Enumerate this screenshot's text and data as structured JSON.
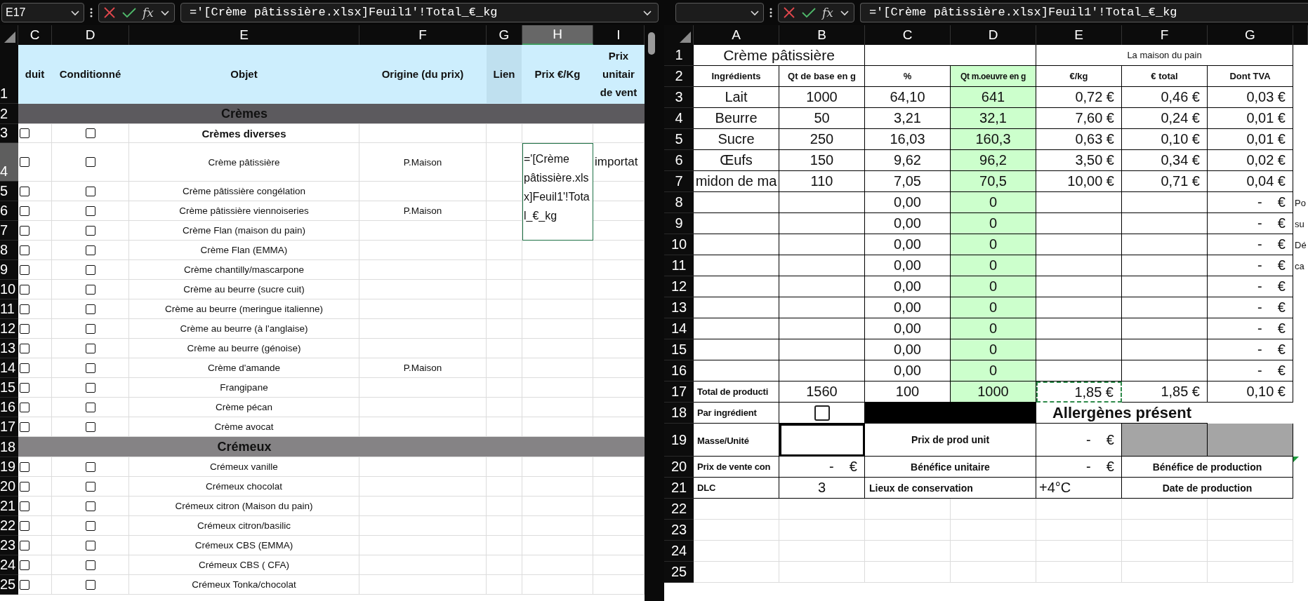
{
  "left_pane": {
    "name_box": "E17",
    "function_label": "fx",
    "formula": "='[Crème pâtissière.xlsx]Feuil1'!Total_€_kg",
    "columns": [
      {
        "label": "C",
        "selected": false
      },
      {
        "label": "D",
        "selected": false
      },
      {
        "label": "E",
        "selected": false
      },
      {
        "label": "F",
        "selected": false
      },
      {
        "label": "G",
        "selected": false
      },
      {
        "label": "H",
        "selected": true
      },
      {
        "label": "I",
        "selected": false
      }
    ],
    "rows": [
      {
        "number": "1",
        "kind": "header",
        "selected": false,
        "cells": [
          "duit",
          "Conditionné",
          "Objet",
          "Origine (du prix)",
          "Lien",
          "Prix €/Kg",
          "Prix\nunitair\nde vent"
        ]
      },
      {
        "number": "2",
        "kind": "section",
        "selected": false,
        "title": "Crèmes",
        "color": "#5c5a5e"
      },
      {
        "number": "3",
        "kind": "subheading",
        "selected": false,
        "checks": [
          {
            "checked": false
          },
          {
            "checked": false
          }
        ],
        "object": "Crèmes diverses"
      },
      {
        "number": "4",
        "kind": "editing",
        "selected": true,
        "checks": [
          {
            "checked": false
          },
          {
            "checked": false
          }
        ],
        "object": "Crème pâtissière",
        "origin": "P.Maison",
        "price": "='[Crème pâtissière.xlsx]Feuil1'!Total_€_kg",
        "unit_price": "importat"
      },
      {
        "number": "5",
        "kind": "item",
        "selected": false,
        "checks": [
          {
            "checked": false
          },
          {
            "checked": false
          }
        ],
        "object": "Crème pâtissière congélation"
      },
      {
        "number": "6",
        "kind": "item",
        "selected": false,
        "checks": [
          {
            "checked": false
          },
          {
            "checked": false
          }
        ],
        "object": "Crème pâtissière viennoiseries",
        "origin": "P.Maison"
      },
      {
        "number": "7",
        "kind": "item",
        "selected": false,
        "checks": [
          {
            "checked": false
          },
          {
            "checked": false
          }
        ],
        "object": "Crème Flan (maison du pain)"
      },
      {
        "number": "8",
        "kind": "item",
        "selected": false,
        "checks": [
          {
            "checked": false
          },
          {
            "checked": false
          }
        ],
        "object": "Crème Flan (EMMA)"
      },
      {
        "number": "9",
        "kind": "item",
        "selected": false,
        "checks": [
          {
            "checked": false
          },
          {
            "checked": false
          }
        ],
        "object": "Crème chantilly/mascarpone"
      },
      {
        "number": "10",
        "kind": "item",
        "selected": false,
        "checks": [
          {
            "checked": false
          },
          {
            "checked": false
          }
        ],
        "object": "Crème au beurre (sucre cuit)"
      },
      {
        "number": "11",
        "kind": "item",
        "selected": false,
        "checks": [
          {
            "checked": false
          },
          {
            "checked": false
          }
        ],
        "object": "Crème au beurre (meringue italienne)"
      },
      {
        "number": "12",
        "kind": "item",
        "selected": false,
        "checks": [
          {
            "checked": false
          },
          {
            "checked": false
          }
        ],
        "object": "Crème au beurre (à l'anglaise)"
      },
      {
        "number": "13",
        "kind": "item",
        "selected": false,
        "checks": [
          {
            "checked": false
          },
          {
            "checked": false
          }
        ],
        "object": "Crème au beurre (génoise)"
      },
      {
        "number": "14",
        "kind": "item",
        "selected": false,
        "checks": [
          {
            "checked": false
          },
          {
            "checked": false
          }
        ],
        "object": "Crème d'amande",
        "origin": "P.Maison"
      },
      {
        "number": "15",
        "kind": "item",
        "selected": false,
        "checks": [
          {
            "checked": false
          },
          {
            "checked": false
          }
        ],
        "object": "Frangipane"
      },
      {
        "number": "16",
        "kind": "item",
        "selected": false,
        "checks": [
          {
            "checked": false
          },
          {
            "checked": false
          }
        ],
        "object": "Crème pécan"
      },
      {
        "number": "17",
        "kind": "item",
        "selected": false,
        "checks": [
          {
            "checked": false
          },
          {
            "checked": false
          }
        ],
        "object": "Crème avocat"
      },
      {
        "number": "18",
        "kind": "section",
        "selected": false,
        "title": "Crémeux",
        "color": "#858385"
      },
      {
        "number": "19",
        "kind": "item",
        "selected": false,
        "checks": [
          {
            "checked": false
          },
          {
            "checked": false
          }
        ],
        "object": "Crémeux vanille"
      },
      {
        "number": "20",
        "kind": "item",
        "selected": false,
        "checks": [
          {
            "checked": false
          },
          {
            "checked": false
          }
        ],
        "object": "Crémeux chocolat"
      },
      {
        "number": "21",
        "kind": "item",
        "selected": false,
        "checks": [
          {
            "checked": false
          },
          {
            "checked": false
          }
        ],
        "object": "Crémeux citron (Maison du pain)"
      },
      {
        "number": "22",
        "kind": "item",
        "selected": false,
        "checks": [
          {
            "checked": false
          },
          {
            "checked": false
          }
        ],
        "object": "Crémeux citron/basilic"
      },
      {
        "number": "23",
        "kind": "item",
        "selected": false,
        "checks": [
          {
            "checked": false
          },
          {
            "checked": false
          }
        ],
        "object": "Crémeux CBS (EMMA)"
      },
      {
        "number": "24",
        "kind": "item",
        "selected": false,
        "checks": [
          {
            "checked": false
          },
          {
            "checked": false
          }
        ],
        "object": "Crémeux CBS ( CFA)"
      },
      {
        "number": "25",
        "kind": "item",
        "selected": false,
        "checks": [
          {
            "checked": false
          },
          {
            "checked": false
          }
        ],
        "object": "Crémeux Tonka/chocolat"
      }
    ]
  },
  "right_pane": {
    "function_label": "fx",
    "formula": "='[Crème pâtissière.xlsx]Feuil1'!Total_€_kg",
    "columns": [
      "A",
      "B",
      "C",
      "D",
      "E",
      "F",
      "G"
    ],
    "rows": [
      {
        "number": "1",
        "kind": "standard",
        "cells": [
          {
            "kind": "title",
            "text": "Crème pâtissière"
          },
          {
            "kind": "blank_wide"
          },
          {
            "kind": "banner",
            "text": "La maison du pain"
          }
        ]
      },
      {
        "number": "2",
        "kind": "standard",
        "cells": [
          {
            "kind": "head",
            "text": "Ingrédients"
          },
          {
            "kind": "head",
            "text": "Qt de base en g"
          },
          {
            "kind": "head",
            "text": "%"
          },
          {
            "kind": "green_head",
            "text": "Qt m.oeuvre en g"
          },
          {
            "kind": "head",
            "text": "€/kg"
          },
          {
            "kind": "head",
            "text": "€ total"
          },
          {
            "kind": "head",
            "text": "Dont TVA"
          }
        ]
      },
      {
        "number": "3",
        "kind": "standard",
        "cells": [
          {
            "kind": "num",
            "text": "Lait"
          },
          {
            "kind": "num",
            "text": "1000"
          },
          {
            "kind": "num",
            "text": "64,10"
          },
          {
            "kind": "green",
            "text": "641"
          },
          {
            "kind": "money",
            "text": "0,72 €"
          },
          {
            "kind": "money",
            "text": "0,46 €"
          },
          {
            "kind": "money",
            "text": "0,03 €"
          }
        ]
      },
      {
        "number": "4",
        "kind": "standard",
        "cells": [
          {
            "kind": "num",
            "text": "Beurre"
          },
          {
            "kind": "num",
            "text": "50"
          },
          {
            "kind": "num",
            "text": "3,21"
          },
          {
            "kind": "green",
            "text": "32,1"
          },
          {
            "kind": "money",
            "text": "7,60 €"
          },
          {
            "kind": "money",
            "text": "0,24 €"
          },
          {
            "kind": "money",
            "text": "0,01 €"
          }
        ]
      },
      {
        "number": "5",
        "kind": "standard",
        "cells": [
          {
            "kind": "num",
            "text": "Sucre"
          },
          {
            "kind": "num",
            "text": "250"
          },
          {
            "kind": "num",
            "text": "16,03"
          },
          {
            "kind": "green",
            "text": "160,3"
          },
          {
            "kind": "money",
            "text": "0,63 €"
          },
          {
            "kind": "money",
            "text": "0,10 €"
          },
          {
            "kind": "money",
            "text": "0,01 €"
          }
        ]
      },
      {
        "number": "6",
        "kind": "standard",
        "cells": [
          {
            "kind": "num",
            "text": "Œufs"
          },
          {
            "kind": "num",
            "text": "150"
          },
          {
            "kind": "num",
            "text": "9,62"
          },
          {
            "kind": "green",
            "text": "96,2"
          },
          {
            "kind": "money",
            "text": "3,50 €"
          },
          {
            "kind": "money",
            "text": "0,34 €"
          },
          {
            "kind": "money",
            "text": "0,02 €"
          }
        ]
      },
      {
        "number": "7",
        "kind": "standard",
        "cells": [
          {
            "kind": "num",
            "text": "midon de ma"
          },
          {
            "kind": "num",
            "text": "110"
          },
          {
            "kind": "num",
            "text": "7,05"
          },
          {
            "kind": "green",
            "text": "70,5"
          },
          {
            "kind": "money",
            "text": "10,00 €"
          },
          {
            "kind": "money",
            "text": "0,71 €"
          },
          {
            "kind": "money",
            "text": "0,04 €"
          }
        ]
      },
      {
        "number": "8",
        "kind": "standard",
        "cells": [
          {
            "kind": "blank"
          },
          {
            "kind": "blank"
          },
          {
            "kind": "num",
            "text": "0,00"
          },
          {
            "kind": "green",
            "text": "0"
          },
          {
            "kind": "blank"
          },
          {
            "kind": "blank"
          },
          {
            "kind": "dash",
            "text": "-    €"
          },
          {
            "kind": "spill",
            "text": "Po"
          }
        ]
      },
      {
        "number": "9",
        "kind": "standard",
        "cells": [
          {
            "kind": "blank"
          },
          {
            "kind": "blank"
          },
          {
            "kind": "num",
            "text": "0,00"
          },
          {
            "kind": "green",
            "text": "0"
          },
          {
            "kind": "blank"
          },
          {
            "kind": "blank"
          },
          {
            "kind": "dash",
            "text": "-    €"
          },
          {
            "kind": "spill",
            "text": "su"
          }
        ]
      },
      {
        "number": "10",
        "kind": "standard",
        "cells": [
          {
            "kind": "blank"
          },
          {
            "kind": "blank"
          },
          {
            "kind": "num",
            "text": "0,00"
          },
          {
            "kind": "green",
            "text": "0"
          },
          {
            "kind": "blank"
          },
          {
            "kind": "blank"
          },
          {
            "kind": "dash",
            "text": "-    €"
          },
          {
            "kind": "spill",
            "text": "Dé"
          }
        ]
      },
      {
        "number": "11",
        "kind": "standard",
        "cells": [
          {
            "kind": "blank"
          },
          {
            "kind": "blank"
          },
          {
            "kind": "num",
            "text": "0,00"
          },
          {
            "kind": "green",
            "text": "0"
          },
          {
            "kind": "blank"
          },
          {
            "kind": "blank"
          },
          {
            "kind": "dash",
            "text": "-    €"
          },
          {
            "kind": "spill",
            "text": "ca"
          }
        ]
      },
      {
        "number": "12",
        "kind": "standard",
        "cells": [
          {
            "kind": "blank"
          },
          {
            "kind": "blank"
          },
          {
            "kind": "num",
            "text": "0,00"
          },
          {
            "kind": "green",
            "text": "0"
          },
          {
            "kind": "blank"
          },
          {
            "kind": "blank"
          },
          {
            "kind": "dash",
            "text": "-    €"
          }
        ]
      },
      {
        "number": "13",
        "kind": "standard",
        "cells": [
          {
            "kind": "blank"
          },
          {
            "kind": "blank"
          },
          {
            "kind": "num",
            "text": "0,00"
          },
          {
            "kind": "green",
            "text": "0"
          },
          {
            "kind": "blank"
          },
          {
            "kind": "blank"
          },
          {
            "kind": "dash",
            "text": "-    €"
          }
        ]
      },
      {
        "number": "14",
        "kind": "standard",
        "cells": [
          {
            "kind": "blank"
          },
          {
            "kind": "blank"
          },
          {
            "kind": "num",
            "text": "0,00"
          },
          {
            "kind": "green",
            "text": "0"
          },
          {
            "kind": "blank"
          },
          {
            "kind": "blank"
          },
          {
            "kind": "dash",
            "text": "-    €"
          }
        ]
      },
      {
        "number": "15",
        "kind": "standard",
        "cells": [
          {
            "kind": "blank"
          },
          {
            "kind": "blank"
          },
          {
            "kind": "num",
            "text": "0,00"
          },
          {
            "kind": "green",
            "text": "0"
          },
          {
            "kind": "blank"
          },
          {
            "kind": "blank"
          },
          {
            "kind": "dash",
            "text": "-    €"
          }
        ]
      },
      {
        "number": "16",
        "kind": "standard",
        "cells": [
          {
            "kind": "blank"
          },
          {
            "kind": "blank"
          },
          {
            "kind": "num",
            "text": "0,00"
          },
          {
            "kind": "green",
            "text": "0"
          },
          {
            "kind": "blank"
          },
          {
            "kind": "blank"
          },
          {
            "kind": "dash",
            "text": "-    €"
          }
        ]
      },
      {
        "number": "17",
        "kind": "standard",
        "cells": [
          {
            "kind": "label",
            "text": "Total de producti"
          },
          {
            "kind": "num",
            "text": "1560"
          },
          {
            "kind": "num",
            "text": "100"
          },
          {
            "kind": "green",
            "text": "1000"
          },
          {
            "kind": "marquee",
            "text": "1,85 €"
          },
          {
            "kind": "money",
            "text": "1,85 €"
          },
          {
            "kind": "money",
            "text": "0,10 €"
          }
        ]
      },
      {
        "number": "18",
        "kind": "standard",
        "cells": [
          {
            "kind": "label",
            "text": "Par ingrédient"
          },
          {
            "kind": "checkbox",
            "checked": false
          },
          {
            "kind": "black"
          },
          {
            "kind": "allergen",
            "text": "Allergènes présent"
          }
        ]
      },
      {
        "number": "19",
        "kind": "tall",
        "cells": [
          {
            "kind": "label",
            "text": "Masse/Unité"
          },
          {
            "kind": "box"
          },
          {
            "kind": "caption",
            "text": "Prix de prod unit"
          },
          {
            "kind": "dash",
            "text": "-    €"
          },
          {
            "kind": "gray"
          },
          {
            "kind": "gray"
          }
        ]
      },
      {
        "number": "20",
        "kind": "standard",
        "cells": [
          {
            "kind": "label",
            "text": "Prix de vente con"
          },
          {
            "kind": "dash",
            "text": "-    €"
          },
          {
            "kind": "caption",
            "text": "Bénéfice unitaire"
          },
          {
            "kind": "dash",
            "text": "-    €"
          },
          {
            "kind": "caption",
            "text": "Bénéfice de production"
          },
          {
            "kind": "flag"
          }
        ]
      },
      {
        "number": "21",
        "kind": "standard",
        "cells": [
          {
            "kind": "label",
            "text": "DLC"
          },
          {
            "kind": "num",
            "text": "3"
          },
          {
            "kind": "caption_left",
            "text": "Lieux de conservation"
          },
          {
            "kind": "plain_left",
            "text": "+4°C"
          },
          {
            "kind": "caption",
            "text": "Date de production"
          }
        ]
      },
      {
        "number": "22",
        "kind": "empty"
      },
      {
        "number": "23",
        "kind": "empty"
      },
      {
        "number": "24",
        "kind": "empty"
      },
      {
        "number": "25",
        "kind": "empty"
      }
    ]
  }
}
